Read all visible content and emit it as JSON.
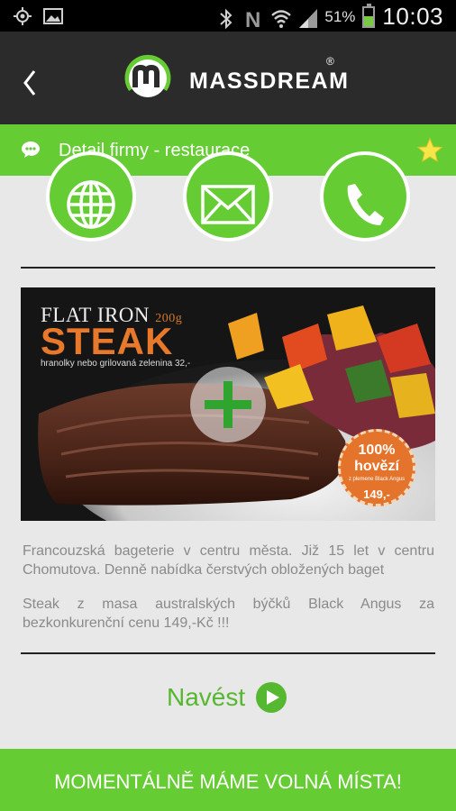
{
  "statusbar": {
    "battery_percent": "51%",
    "battery_level": 0.51,
    "time": "10:03",
    "icons": [
      "gps-icon",
      "image-icon",
      "bluetooth-icon",
      "nfc-icon",
      "wifi-icon",
      "signal-icon",
      "battery-icon"
    ]
  },
  "appbar": {
    "brand": "MASSDREAM",
    "registered": "®",
    "back_icon": "chevron-left-icon"
  },
  "subheader": {
    "title": "Detail firmy - restaurace",
    "icon": "chat-bubble-icon",
    "favorite_icon": "star-icon"
  },
  "actions": [
    {
      "name": "web",
      "icon": "globe-icon"
    },
    {
      "name": "email",
      "icon": "envelope-icon"
    },
    {
      "name": "phone",
      "icon": "phone-icon"
    }
  ],
  "promo": {
    "headline": "FLAT IRON",
    "weight": "200g",
    "product": "STEAK",
    "subline": "hranolky nebo grilovaná zelenina 32,-",
    "badge_line1": "100%",
    "badge_line2": "hovězí",
    "badge_line3": "z plemene Black Angus",
    "badge_price": "149,-"
  },
  "description": {
    "paragraph1": "Francouzská bageterie v centru města. Již 15 let v centru Chomutova. Denně nabídka čerstvých obložených baget",
    "paragraph2": "Steak z masa australských býčků Black Angus za bezkonkurenční cenu 149,-Kč !!!"
  },
  "navigate": {
    "label": "Navést"
  },
  "banner": {
    "text": "MOMENTÁLNĚ MÁME VOLNÁ MÍSTA!"
  },
  "colors": {
    "accent_green": "#66cc33",
    "appbar": "#2b2b2b",
    "promo_orange": "#e8792b"
  }
}
